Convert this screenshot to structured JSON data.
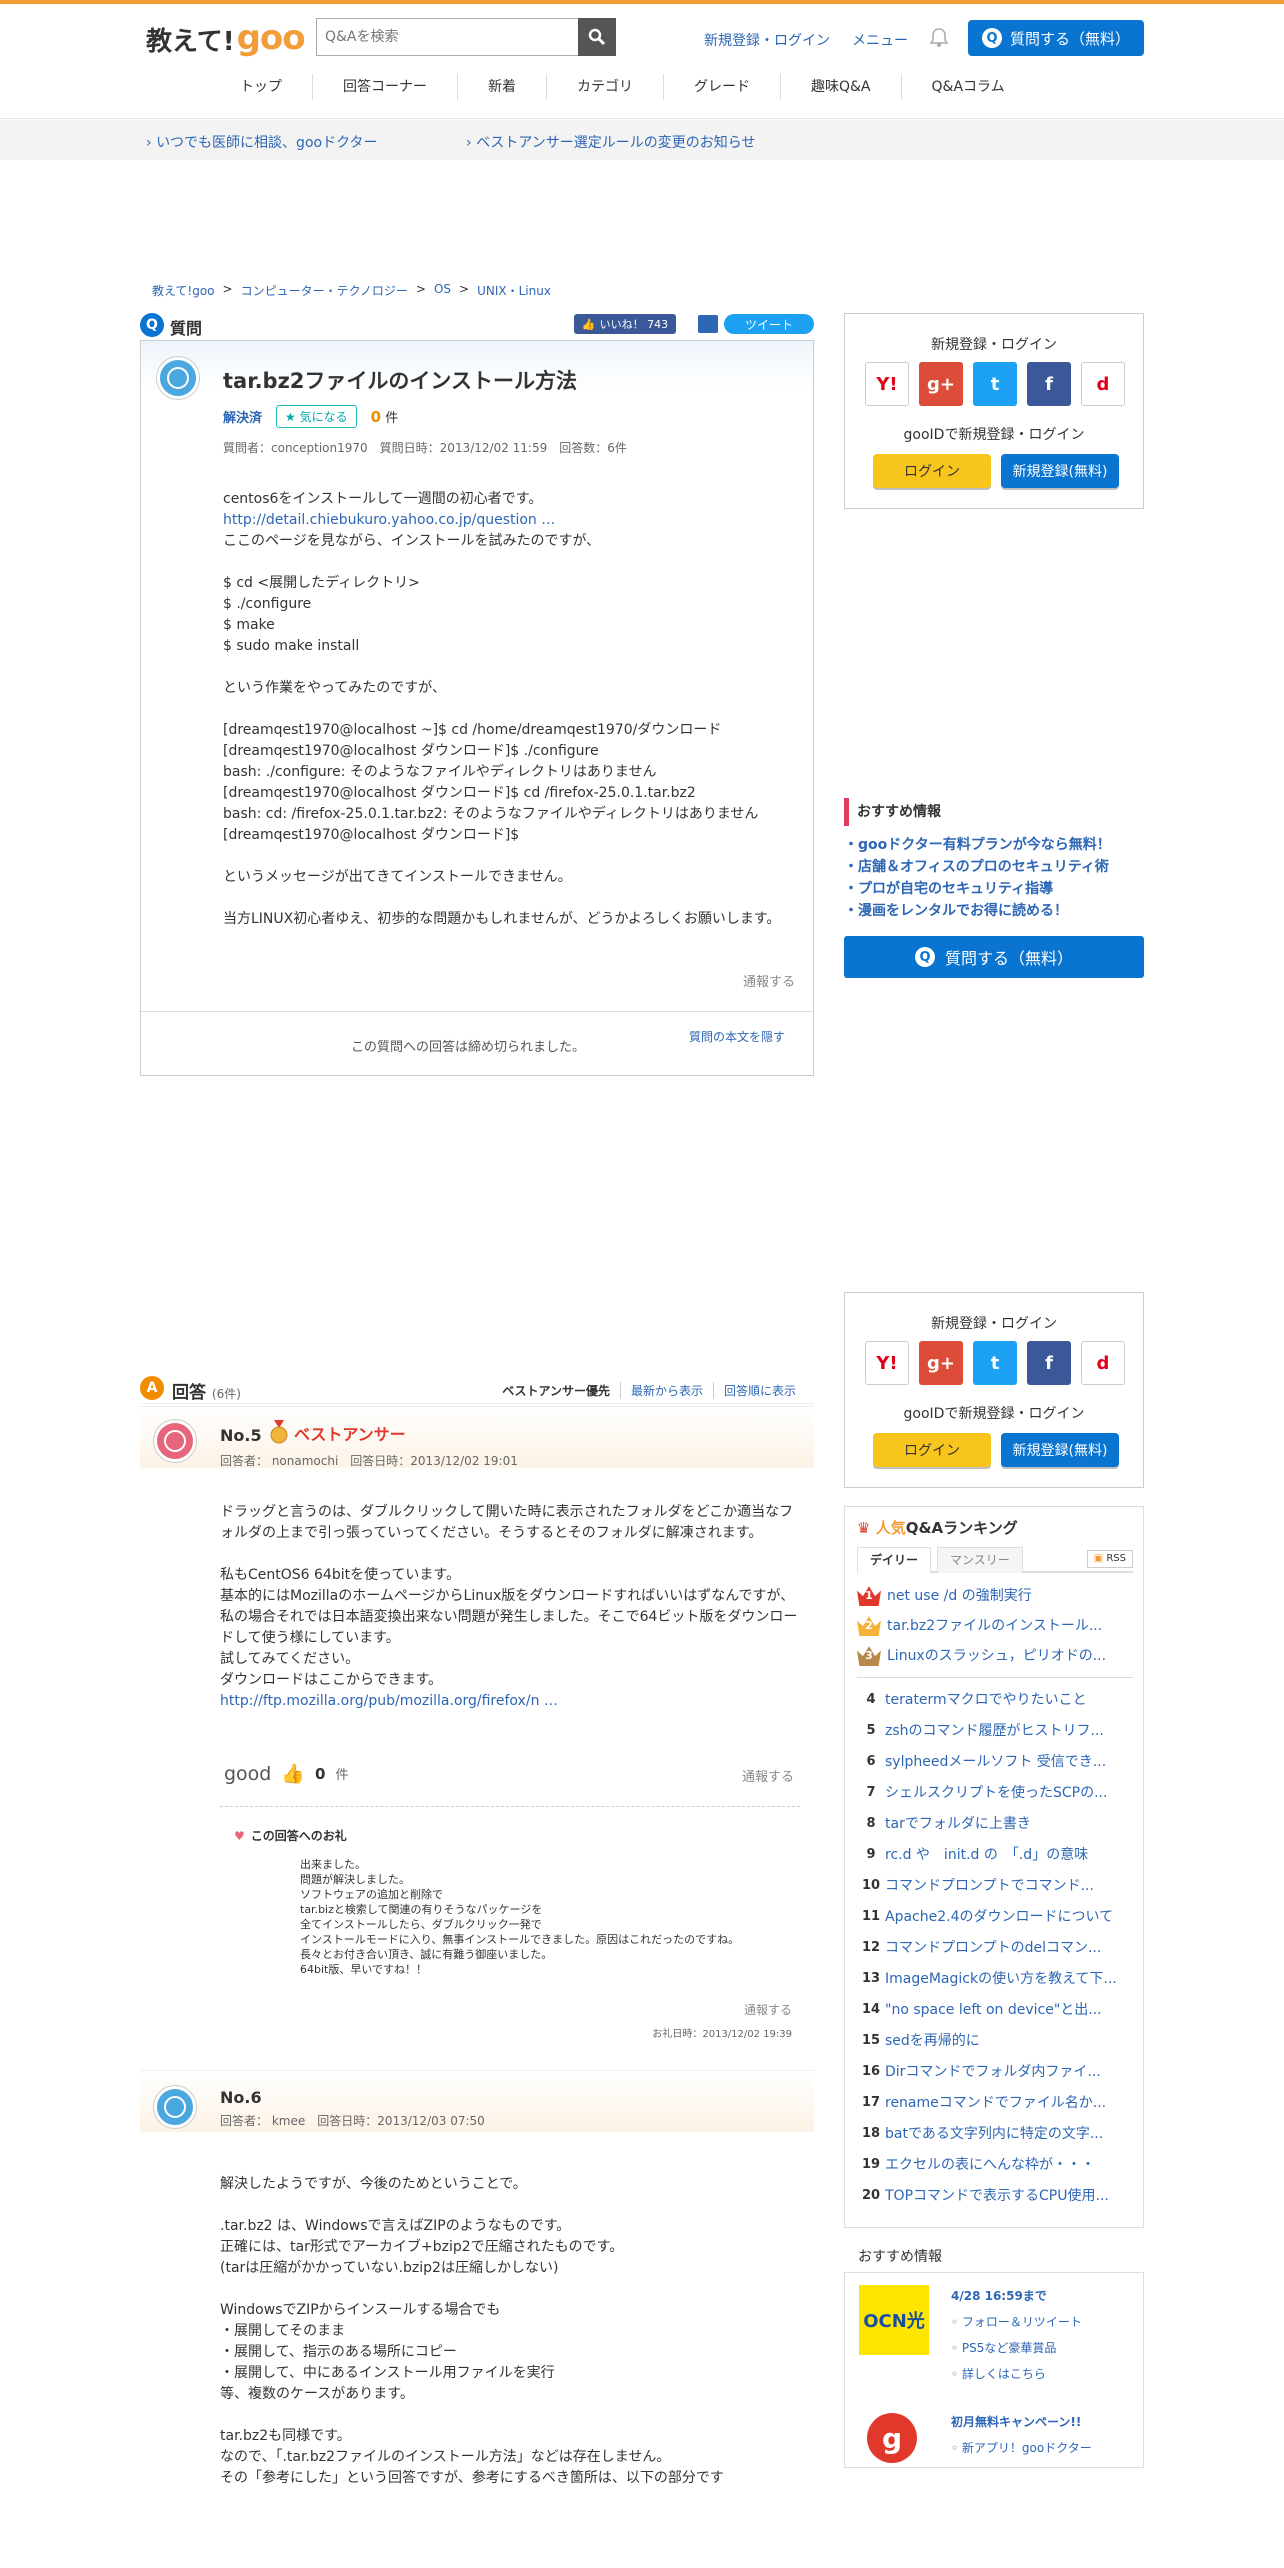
{
  "header": {
    "logo_a": "教えて!",
    "logo_b": "goo",
    "search_placeholder": "Q&Aを検索",
    "login": "新規登録・ログイン",
    "menu": "メニュー",
    "ask": "質問する（無料）",
    "nav": [
      "トップ",
      "回答コーナー",
      "新着",
      "カテゴリ",
      "グレード",
      "趣味Q&A",
      "Q&Aコラム"
    ]
  },
  "notices": [
    "いつでも医師に相談、gooドクター",
    "ベストアンサー選定ルールの変更のお知らせ"
  ],
  "breadcrumb": [
    "教えて!goo",
    "コンピューター・テクノロジー",
    "OS",
    "UNIX・Linux"
  ],
  "question": {
    "label": "質問",
    "like": "いいね！ 743",
    "tweet": "ツイート",
    "title": "tar.bz2ファイルのインストール方法",
    "status": "解決済",
    "fav": "気になる",
    "fav_count": "0",
    "fav_unit": "件",
    "meta": "質問者：conception1970　質問日時：2013/12/02 11:59　回答数：6件",
    "body1": "centos6をインストールして一週間の初心者です。",
    "link": "http://detail.chiebukuro.yahoo.co.jp/question …",
    "body2": "ここのページを見ながら、インストールを試みたのですが、\n\n$ cd <展開したディレクトリ>\n$ ./configure\n$ make\n$ sudo make install\n\nという作業をやってみたのですが、\n\n[dreamqest1970@localhost ~]$ cd /home/dreamqest1970/ダウンロード\n[dreamqest1970@localhost ダウンロード]$ ./configure\nbash: ./configure: そのようなファイルやディレクトリはありません\n[dreamqest1970@localhost ダウンロード]$ cd /firefox-25.0.1.tar.bz2\nbash: cd: /firefox-25.0.1.tar.bz2: そのようなファイルやディレクトリはありません\n[dreamqest1970@localhost ダウンロード]$\n\nというメッセージが出てきてインストールできません。\n\n当方LINUX初心者ゆえ、初歩的な問題かもしれませんが、どうかよろしくお願いします。",
    "report": "通報する",
    "closed": "この質問への回答は締め切られました。",
    "hide": "質問の本文を隠す"
  },
  "login_box": {
    "title": "新規登録・ログイン",
    "sub": "gooIDで新規登録・ログイン",
    "login": "ログイン",
    "register": "新規登録(無料)"
  },
  "recommend": {
    "title": "おすすめ情報",
    "items": [
      "・gooドクター有料プランが今なら無料！",
      "・店舗＆オフィスのプロのセキュリティ術",
      "・プロが自宅のセキュリティ指導",
      "・漫画をレンタルでお得に読める！"
    ],
    "ask": "質問する（無料）"
  },
  "answers": {
    "label": "回答",
    "count": "(6件)",
    "sorts": [
      "ベストアンサー優先",
      "最新から表示",
      "回答順に表示"
    ],
    "a5": {
      "no": "No.5",
      "best": "ベストアンサー",
      "meta": "回答者： nonamochi　回答日時：2013/12/02 19:01",
      "body": "ドラッグと言うのは、ダブルクリックして開いた時に表示されたフォルダをどこか適当なフォルダの上まで引っ張っていってください。そうするとそのフォルダに解凍されます。\n\n私もCentOS6 64bitを使っています。\n基本的にはMozillaのホームページからLinux版をダウンロードすればいいはずなんですが、私の場合それでは日本語変換出来ない問題が発生しました。そこで64ビット版をダウンロードして使う様にしています。\n試してみてください。\nダウンロードはここからできます。",
      "link": "http://ftp.mozilla.org/pub/mozilla.org/firefox/n …",
      "good": "good",
      "good_count": "0",
      "good_unit": "件",
      "report": "通報する",
      "thanks_title": "この回答へのお礼",
      "thanks_body": "出来ました。\n問題が解決しました。\nソフトウェアの追加と削除で\ntar.bizと検索して関連の有りそうなパッケージを\n全てインストールしたら、ダブルクリック一発で\nインストールモードに入り、無事インストールできました。原因はこれだったのですね。\n長々とお付き合い頂き、誠に有難う御座いました。\n64bit版、早いですね！！",
      "thanks_report": "通報する",
      "thanks_date": "お礼日時：2013/12/02 19:39"
    },
    "a6": {
      "no": "No.6",
      "meta": "回答者： kmee　回答日時：2013/12/03 07:50",
      "body": "解決したようですが、今後のためということで。\n\n.tar.bz2 は、Windowsで言えばZIPのようなものです。\n正確には、tar形式でアーカイブ+bzip2で圧縮されたものです。\n(tarは圧縮がかかっていない.bzip2は圧縮しかしない)\n\nWindowsでZIPからインスールする場合でも\n・展開してそのまま\n・展開して、指示のある場所にコピー\n・展開して、中にあるインストール用ファイルを実行\n等、複数のケースがあります。\n\ntar.bz2も同様です。\nなので、「.tar.bz2ファイルのインストール方法」などは存在しません。\nその「参考にした」という回答ですが、参考にするべき箇所は、以下の部分です"
    }
  },
  "ranking": {
    "title_a": "人気",
    "title_b": "Q&Aランキング",
    "tab_daily": "デイリー",
    "tab_monthly": "マンスリー",
    "rss": "RSS",
    "items": [
      {
        "n": "1",
        "t": "net use /d の強制実行"
      },
      {
        "n": "2",
        "t": "tar.bz2ファイルのインストール..."
      },
      {
        "n": "3",
        "t": "Linuxのスラッシュ，ピリオドの..."
      },
      {
        "n": "4",
        "t": "teratermマクロでやりたいこと"
      },
      {
        "n": "5",
        "t": "zshのコマンド履歴がヒストリフ..."
      },
      {
        "n": "6",
        "t": "sylpheedメールソフト 受信でき..."
      },
      {
        "n": "7",
        "t": "シェルスクリプトを使ったSCPの..."
      },
      {
        "n": "8",
        "t": "tarでフォルダに上書き"
      },
      {
        "n": "9",
        "t": "rc.d や　init.d の　「.d」の意味"
      },
      {
        "n": "10",
        "t": "コマンドプロンプトでコマンド..."
      },
      {
        "n": "11",
        "t": "Apache2.4のダウンロードについて"
      },
      {
        "n": "12",
        "t": "コマンドプロンプトのdelコマン..."
      },
      {
        "n": "13",
        "t": "ImageMagickの使い方を教えて下..."
      },
      {
        "n": "14",
        "t": "\"no space left on device\"と出..."
      },
      {
        "n": "15",
        "t": "sedを再帰的に"
      },
      {
        "n": "16",
        "t": "Dirコマンドでフォルダ内ファイ..."
      },
      {
        "n": "17",
        "t": "renameコマンドでファイル名か..."
      },
      {
        "n": "18",
        "t": "batである文字列内に特定の文字..."
      },
      {
        "n": "19",
        "t": "エクセルの表にへんな枠が・・・"
      },
      {
        "n": "20",
        "t": "TOPコマンドで表示するCPU使用..."
      }
    ]
  },
  "promo": {
    "title": "おすすめ情報",
    "ocn": "OCN光",
    "p1_title": "4/28 16:59まで",
    "p1_items": [
      "フォロー＆リツイート",
      "PS5など豪華賞品",
      "詳しくはこちら"
    ],
    "p2_title": "初月無料キャンペーン!!",
    "p2_items": [
      "新アプリ！gooドクター"
    ]
  },
  "colors": {
    "accent": "#f39c3a",
    "primary": "#0a74d1",
    "link": "#2d66b5",
    "best": "#e0392b"
  }
}
